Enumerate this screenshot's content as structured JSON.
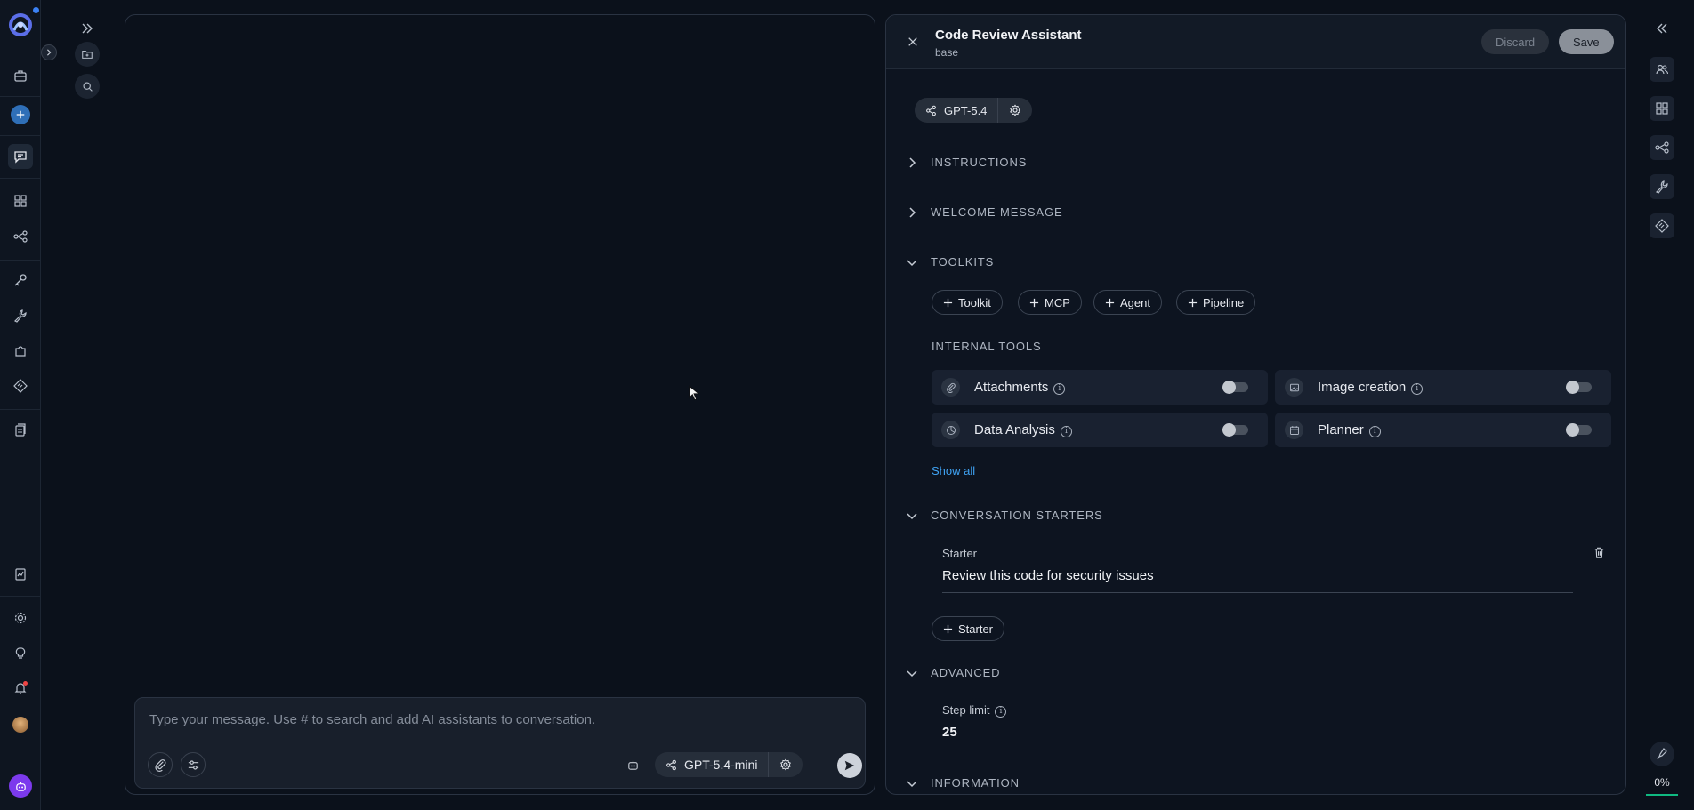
{
  "chat": {
    "composer_placeholder": "Type your message. Use # to search and add AI assistants to conversation.",
    "model_name": "GPT-5.4-mini"
  },
  "config": {
    "title": "Code Review Assistant",
    "subtitle": "base",
    "discard_label": "Discard",
    "save_label": "Save",
    "model_name": "GPT-5.4",
    "sections": {
      "instructions": "INSTRUCTIONS",
      "welcome": "WELCOME MESSAGE",
      "toolkits": "TOOLKITS",
      "starters": "CONVERSATION STARTERS",
      "advanced": "ADVANCED",
      "information": "INFORMATION"
    },
    "toolkit_chips": [
      "Toolkit",
      "MCP",
      "Agent",
      "Pipeline"
    ],
    "internal_tools_label": "INTERNAL TOOLS",
    "internal_tools": [
      {
        "name": "Attachments",
        "icon": "paperclip-icon",
        "enabled": false
      },
      {
        "name": "Image creation",
        "icon": "image-icon",
        "enabled": false
      },
      {
        "name": "Data Analysis",
        "icon": "analysis-icon",
        "enabled": false
      },
      {
        "name": "Planner",
        "icon": "calendar-icon",
        "enabled": false
      }
    ],
    "show_all_label": "Show all",
    "starter_label": "Starter",
    "starter_value": "Review this code for security issues",
    "add_starter_label": "Starter",
    "step_limit_label": "Step limit",
    "step_limit_value": "25"
  },
  "right_rail": {
    "progress_text": "0%",
    "progress_value": 0
  },
  "colors": {
    "accent_link": "#3fa2f2",
    "progress_green": "#10b981",
    "logo_blue": "#3b82f6"
  }
}
